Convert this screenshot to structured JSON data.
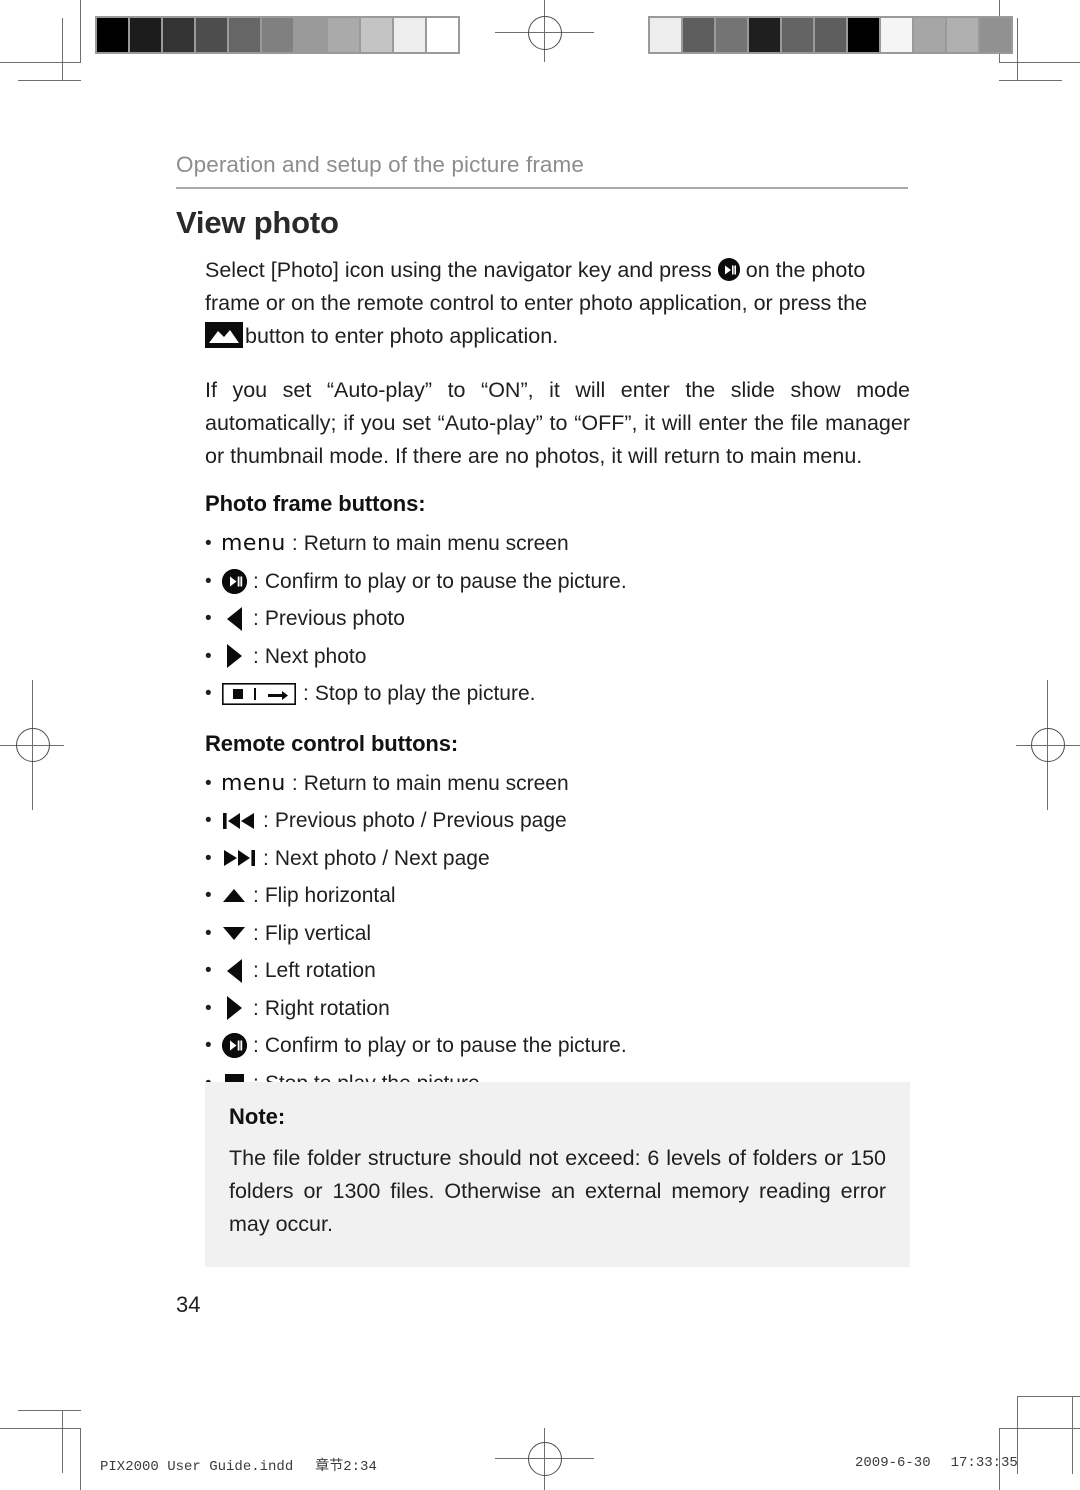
{
  "document": {
    "running_header": "Operation and setup of the picture frame",
    "title": "View photo",
    "page_number": "34"
  },
  "intro": {
    "paragraph_1_part_1": "Select [Photo] icon using the navigator key and press",
    "paragraph_1_part_2": "on the photo frame or on the remote control to enter photo application, or press the",
    "paragraph_1_part_3": "button to enter photo application.",
    "paragraph_2": "If you set “Auto-play” to “ON”, it will enter the slide show mode automatically; if you set “Auto-play” to “OFF”, it will enter the file manager or thumbnail mode. If there are no photos, it will return to main menu."
  },
  "photo_frame_buttons": {
    "heading": "Photo frame buttons:",
    "bullet": "•",
    "items": [
      {
        "icon": "menu-text-icon",
        "icon_text": "menu",
        "separator": ":",
        "label": "Return to main menu screen"
      },
      {
        "icon": "play-pause-circle-icon",
        "icon_text": "",
        "separator": ":",
        "label": "Confirm to play or to pause the picture."
      },
      {
        "icon": "triangle-left-icon",
        "icon_text": "",
        "separator": ":",
        "label": "Previous photo"
      },
      {
        "icon": "triangle-right-icon",
        "icon_text": "",
        "separator": ":",
        "label": "Next photo"
      },
      {
        "icon": "stop-bar-button-icon",
        "icon_text": "",
        "separator": ":",
        "label": "Stop to play the picture."
      }
    ]
  },
  "remote_control_buttons": {
    "heading": "Remote control buttons:",
    "bullet": "•",
    "items": [
      {
        "icon": "menu-text-icon",
        "icon_text": "menu",
        "separator": ":",
        "label": "Return to main menu screen"
      },
      {
        "icon": "previous-track-icon",
        "icon_text": "",
        "separator": ":",
        "label": "Previous photo / Previous page"
      },
      {
        "icon": "next-track-icon",
        "icon_text": "",
        "separator": ":",
        "label": "Next photo / Next page"
      },
      {
        "icon": "triangle-up-icon",
        "icon_text": "",
        "separator": ":",
        "label": "Flip horizontal"
      },
      {
        "icon": "triangle-down-icon",
        "icon_text": "",
        "separator": ":",
        "label": "Flip vertical"
      },
      {
        "icon": "triangle-left-icon",
        "icon_text": "",
        "separator": ":",
        "label": "Left rotation"
      },
      {
        "icon": "triangle-right-icon",
        "icon_text": "",
        "separator": ":",
        "label": "Right rotation"
      },
      {
        "icon": "play-pause-circle-icon",
        "icon_text": "",
        "separator": ":",
        "label": "Confirm to play or to pause the picture."
      },
      {
        "icon": "stop-square-icon",
        "icon_text": "",
        "separator": ":",
        "label": "Stop to play the picture."
      }
    ]
  },
  "note": {
    "title": "Note:",
    "body": "The file folder structure should not exceed: 6 levels of folders or 150 folders or 1300 files. Otherwise an external memory reading error may occur.",
    "background_color": "#f1f1f1"
  },
  "footer": {
    "file_name": "PIX2000 User Guide.indd",
    "section": "章节2:34",
    "date": "2009-6-30",
    "time": "17:33:35"
  },
  "print_marks": {
    "calibration_bar_left": {
      "name": "grayscale-step-wedge",
      "swatches": [
        "#000000",
        "#1c1c1c",
        "#333333",
        "#4d4d4d",
        "#666666",
        "#808080",
        "#999999",
        "#aaaaaa",
        "#c4c4c4",
        "#ededed",
        "#ffffff"
      ]
    },
    "calibration_bar_right": {
      "name": "grayscale-scrambled-wedge",
      "swatches": [
        "#ededed",
        "#5e5e5e",
        "#747474",
        "#1f1f1f",
        "#646464",
        "#5e5e5e",
        "#000000",
        "#f5f5f5",
        "#a6a6a6",
        "#b0b0b0",
        "#919191"
      ]
    },
    "registration_mark": "registration-crosshair"
  }
}
